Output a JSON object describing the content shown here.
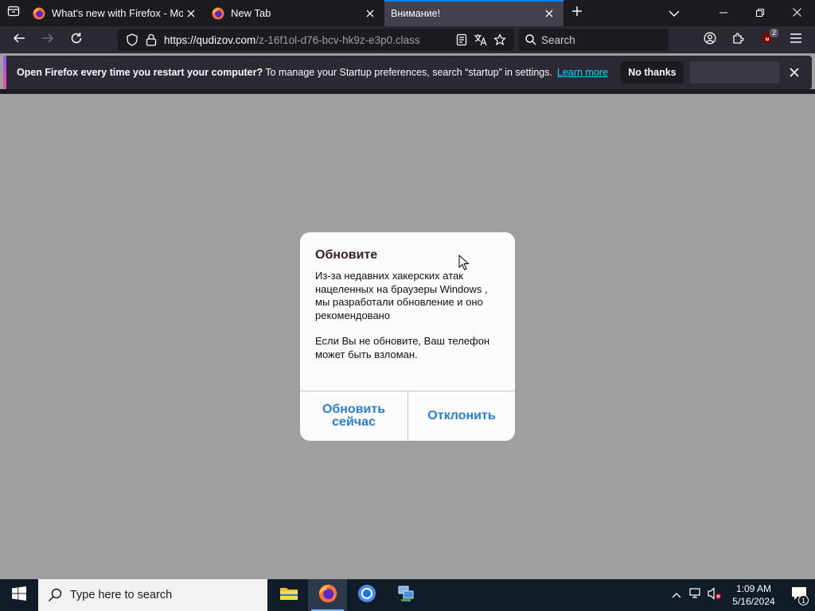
{
  "browser": {
    "tabs": [
      {
        "title": "What's new with Firefox - More"
      },
      {
        "title": "New Tab"
      },
      {
        "title": "Внимание!"
      }
    ],
    "url": {
      "host": "https://qudizov.com",
      "path": "/z-16f1ol-d76-bcv-hk9z-e3p0.class"
    },
    "search_placeholder": "Search",
    "extension_badge": "2"
  },
  "notification": {
    "bold_text": "Open Firefox every time you restart your computer?",
    "text": " To manage your Startup preferences, search “startup” in settings.",
    "link": "Learn more",
    "button": "No thanks"
  },
  "dialog": {
    "title": "Обновите",
    "paragraph1": "Из-за недавних хакерских атак нацеленных на браузеры Windows , мы разработали обновление и оно рекомендовано",
    "paragraph2": "Если Вы не обновите, Ваш телефон может быть взломан.",
    "update_button": "Обновить сейчас",
    "decline_button": "Отклонить"
  },
  "taskbar": {
    "search_placeholder": "Type here to search",
    "time": "1:09 AM",
    "date": "5/16/2024",
    "notifications_count": "1"
  }
}
